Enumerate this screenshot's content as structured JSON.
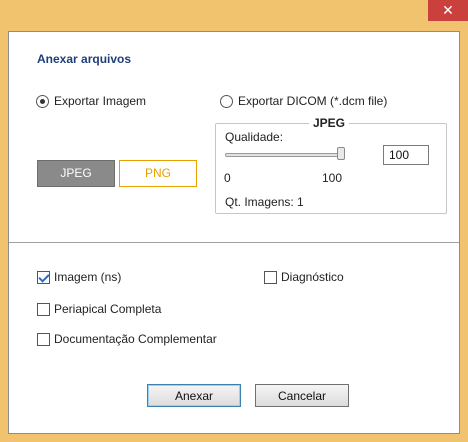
{
  "window": {
    "close_glyph": "✕"
  },
  "section_title": "Anexar arquivos",
  "export_options": [
    {
      "label": "Exportar Imagem",
      "checked": true
    },
    {
      "label": "Exportar DICOM (*.dcm file)",
      "checked": false
    }
  ],
  "format_buttons": {
    "jpeg": "JPEG",
    "png": "PNG",
    "selected": "JPEG"
  },
  "jpeg_group": {
    "title": "JPEG",
    "quality_label": "Qualidade:",
    "slider_min": "0",
    "slider_max": "100",
    "slider_value_fraction": 1.0,
    "quality_value": "100",
    "images_count_label": "Qt. Imagens: 1"
  },
  "checkboxes": [
    {
      "label": "Imagem (ns)",
      "checked": true
    },
    {
      "label": "Diagnóstico",
      "checked": false
    },
    {
      "label": "Periapical Completa",
      "checked": false
    },
    {
      "label": "Documentação Complementar",
      "checked": false
    }
  ],
  "actions": {
    "attach": "Anexar",
    "cancel": "Cancelar"
  },
  "colors": {
    "title_bar": "#f2c36f",
    "close_button": "#c9403c",
    "section_title": "#1f3f7a",
    "png_accent": "#e8a000",
    "jpeg_selected": "#8a8a8a"
  }
}
